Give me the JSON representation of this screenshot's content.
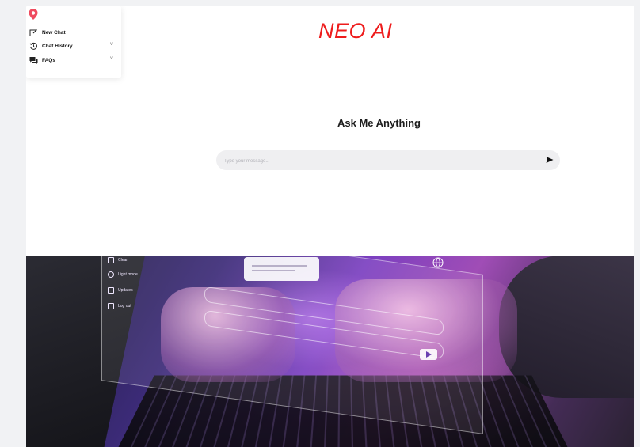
{
  "header": {
    "brand": "NEO AI"
  },
  "sidebar": {
    "items": [
      {
        "label": "New Chat",
        "icon": "edit-icon",
        "has_chevron": false
      },
      {
        "label": "Chat History",
        "icon": "history-icon",
        "has_chevron": true
      },
      {
        "label": "FAQs",
        "icon": "chat-bubbles-icon",
        "has_chevron": true
      }
    ]
  },
  "main": {
    "title": "Ask Me Anything",
    "input": {
      "placeholder": "Type your message...",
      "value": ""
    }
  },
  "hero_image": {
    "panel_items": [
      "Clear",
      "Light mode",
      "Updates",
      "Log out"
    ]
  },
  "colors": {
    "brand": "#ee1c1c",
    "logo": "#ef4b5f",
    "input_bg": "#efeff1",
    "accent_purple": "#7b3fc0"
  }
}
